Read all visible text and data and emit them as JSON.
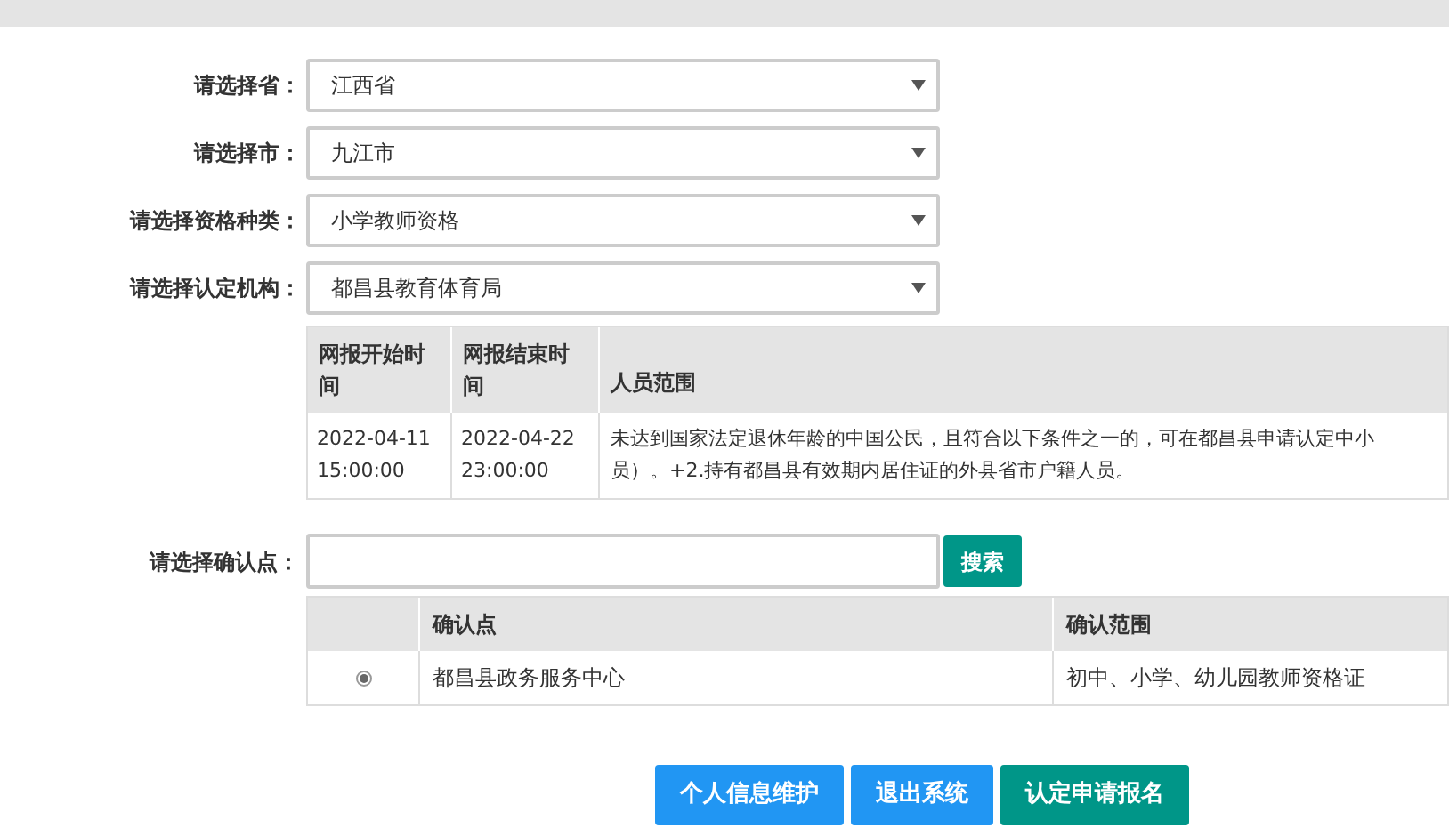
{
  "selects": [
    {
      "label": "请选择省：",
      "value": "江西省"
    },
    {
      "label": "请选择市：",
      "value": "九江市"
    },
    {
      "label": "请选择资格种类：",
      "value": "小学教师资格"
    },
    {
      "label": "请选择认定机构：",
      "value": "都昌县教育体育局"
    }
  ],
  "period_table": {
    "columns": [
      "网报开始时间",
      "网报结束时间",
      "人员范围"
    ],
    "rows": [
      {
        "start": "2022-04-11 15:00:00",
        "end": "2022-04-22 23:00:00",
        "scope_lines": [
          "未达到国家法定退休年龄的中国公民，且符合以下条件之一的，可在都昌县申请认定中小",
          "员）。+2.持有都昌县有效期内居住证的外县省市户籍人员。"
        ]
      }
    ]
  },
  "search": {
    "label": "请选择确认点：",
    "button": "搜索"
  },
  "site_table": {
    "columns": [
      "确认点",
      "确认范围"
    ],
    "rows": [
      {
        "selected": true,
        "name": "都昌县政务服务中心",
        "scope": "初中、小学、幼儿园教师资格证"
      }
    ]
  },
  "buttons": [
    {
      "label": "个人信息维护",
      "kind": "blue"
    },
    {
      "label": "退出系统",
      "kind": "blue"
    },
    {
      "label": "认定申请报名",
      "kind": "green"
    }
  ]
}
